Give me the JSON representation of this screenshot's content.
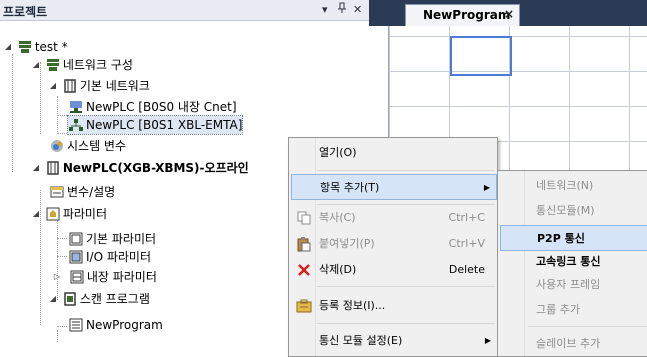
{
  "panel": {
    "title": "프로젝트",
    "pin_glyph": "▾",
    "pin2_glyph": "ᵽ",
    "close_glyph": "✕"
  },
  "tree": {
    "root": "test *",
    "network_config": "네트워크 구성",
    "basic_network": "기본 네트워크",
    "plc_cnet": "NewPLC [B0S0 내장 Cnet]",
    "plc_emta": "NewPLC [B0S1 XBL-EMTA]",
    "system_vars": "시스템 변수",
    "plc_node": "NewPLC(XGB-XBMS)-오프라인",
    "vars_desc": "변수/설명",
    "params": "파라미터",
    "basic_params": "기본 파라미터",
    "io_params": "I/O 파라미터",
    "builtin_params": "내장 파라미터",
    "scan_program": "스캔 프로그램",
    "new_program": "NewProgram"
  },
  "editor": {
    "tab_label": "NewProgram",
    "tab_close": "×"
  },
  "context_menu": {
    "open": "열기(O)",
    "add_item": "항목 추가(T)",
    "copy": "복사(C)",
    "copy_shortcut": "Ctrl+C",
    "paste": "붙여넣기(P)",
    "paste_shortcut": "Ctrl+V",
    "delete": "삭제(D)",
    "delete_shortcut": "Delete",
    "reg_info": "등록 정보(I)...",
    "comm_module_setting": "통신 모듈 설정(E)"
  },
  "submenu": {
    "network": "네트워크(N)",
    "comm_module": "통신모듈(M)",
    "p2p": "P2P 통신",
    "highspeed_link": "고속링크 통신",
    "user_frame": "사용자 프레임",
    "group_add": "그룹 추가",
    "slave_add": "슬레이브 추가"
  },
  "colors": {
    "accent": "#4b7bd4",
    "menu_hover": "#d5e5f7",
    "tabstrip": "#2b3a55",
    "delete_red": "#d02020"
  }
}
